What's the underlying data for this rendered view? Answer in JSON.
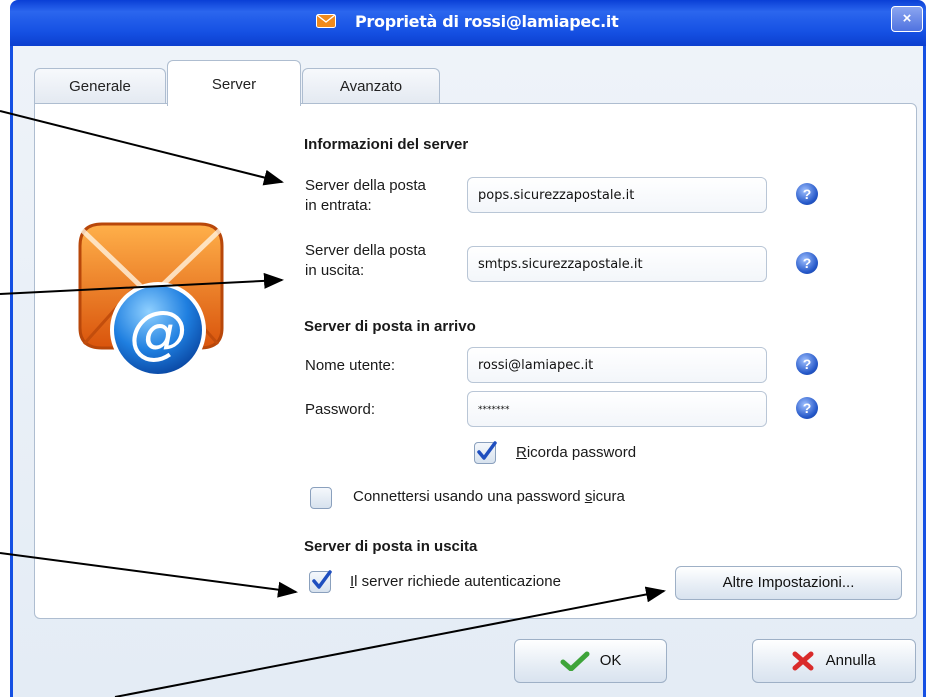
{
  "window": {
    "title": "Proprietà di rossi@lamiapec.it",
    "close_label": "×"
  },
  "tabs": [
    {
      "label": "Generale"
    },
    {
      "label": "Server"
    },
    {
      "label": "Avanzato"
    }
  ],
  "server_info": {
    "heading": "Informazioni del server",
    "incoming_label_line1": "Server della posta",
    "incoming_label_line2": "in entrata:",
    "incoming_value": "pops.sicurezzapostale.it",
    "outgoing_label_line1": "Server della posta",
    "outgoing_label_line2": "in uscita:",
    "outgoing_value": "smtps.sicurezzapostale.it"
  },
  "incoming_server": {
    "heading": "Server di posta in arrivo",
    "username_label": "Nome utente:",
    "username_value": "rossi@lamiapec.it",
    "password_label": "Password:",
    "password_value": "*******",
    "remember_prefix": "R",
    "remember_rest": "icorda password",
    "remember_checked": true,
    "secure_prefix": "Connettersi usando una password ",
    "secure_underlined": "s",
    "secure_rest": "icura",
    "secure_checked": false
  },
  "outgoing_server": {
    "heading": "Server di posta in uscita",
    "auth_prefix": "I",
    "auth_rest": "l server richiede autenticazione",
    "auth_checked": true,
    "more_settings_label": "Altre Impostazioni..."
  },
  "help_glyph": "?",
  "buttons": {
    "ok": "OK",
    "cancel": "Annulla"
  },
  "colors": {
    "titlebar": "#1550e3",
    "checkmark": "#1f4fbf",
    "ok_icon": "#3ea43a",
    "cancel_icon": "#d92b2b"
  }
}
